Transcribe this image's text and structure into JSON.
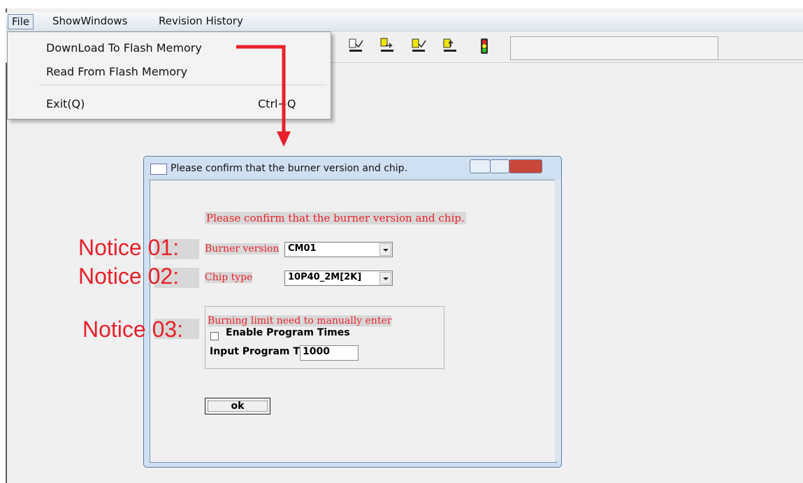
{
  "menu": {
    "items": [
      "File",
      "ShowWindows",
      "Revision History"
    ]
  },
  "file_menu": {
    "download": "DownLoad To Flash Memory",
    "read": "Read From Flash Memory",
    "exit": "Exit(Q)",
    "exit_shortcut": "Ctrl+Q"
  },
  "toolbar": {
    "icons": [
      "download-check-icon",
      "copy-arrow-icon",
      "download-check-icon",
      "upload-icon",
      "traffic-light-icon"
    ]
  },
  "dialog": {
    "title": "Please confirm that the burner version and chip.",
    "confirm_text": "Please confirm that the burner version and chip.",
    "burner_label": "Burner version",
    "burner_value": "CM01",
    "chip_label": "Chip type",
    "chip_value": "10P40_2M[2K]",
    "burning_limit_label": "Burning limit need to manually enter",
    "enable_label": "Enable Program Times",
    "input_label": "Input Program T",
    "input_value": "1000",
    "ok_label": "ok"
  },
  "annotations": {
    "notice1": "Notice 01:",
    "notice2": "Notice 02:",
    "notice3": "Notice 03:"
  },
  "colors": {
    "annotation_red": "#e8202a",
    "menu_highlight": "#e3ecf7",
    "dialog_frame": "#cfe0f2"
  }
}
